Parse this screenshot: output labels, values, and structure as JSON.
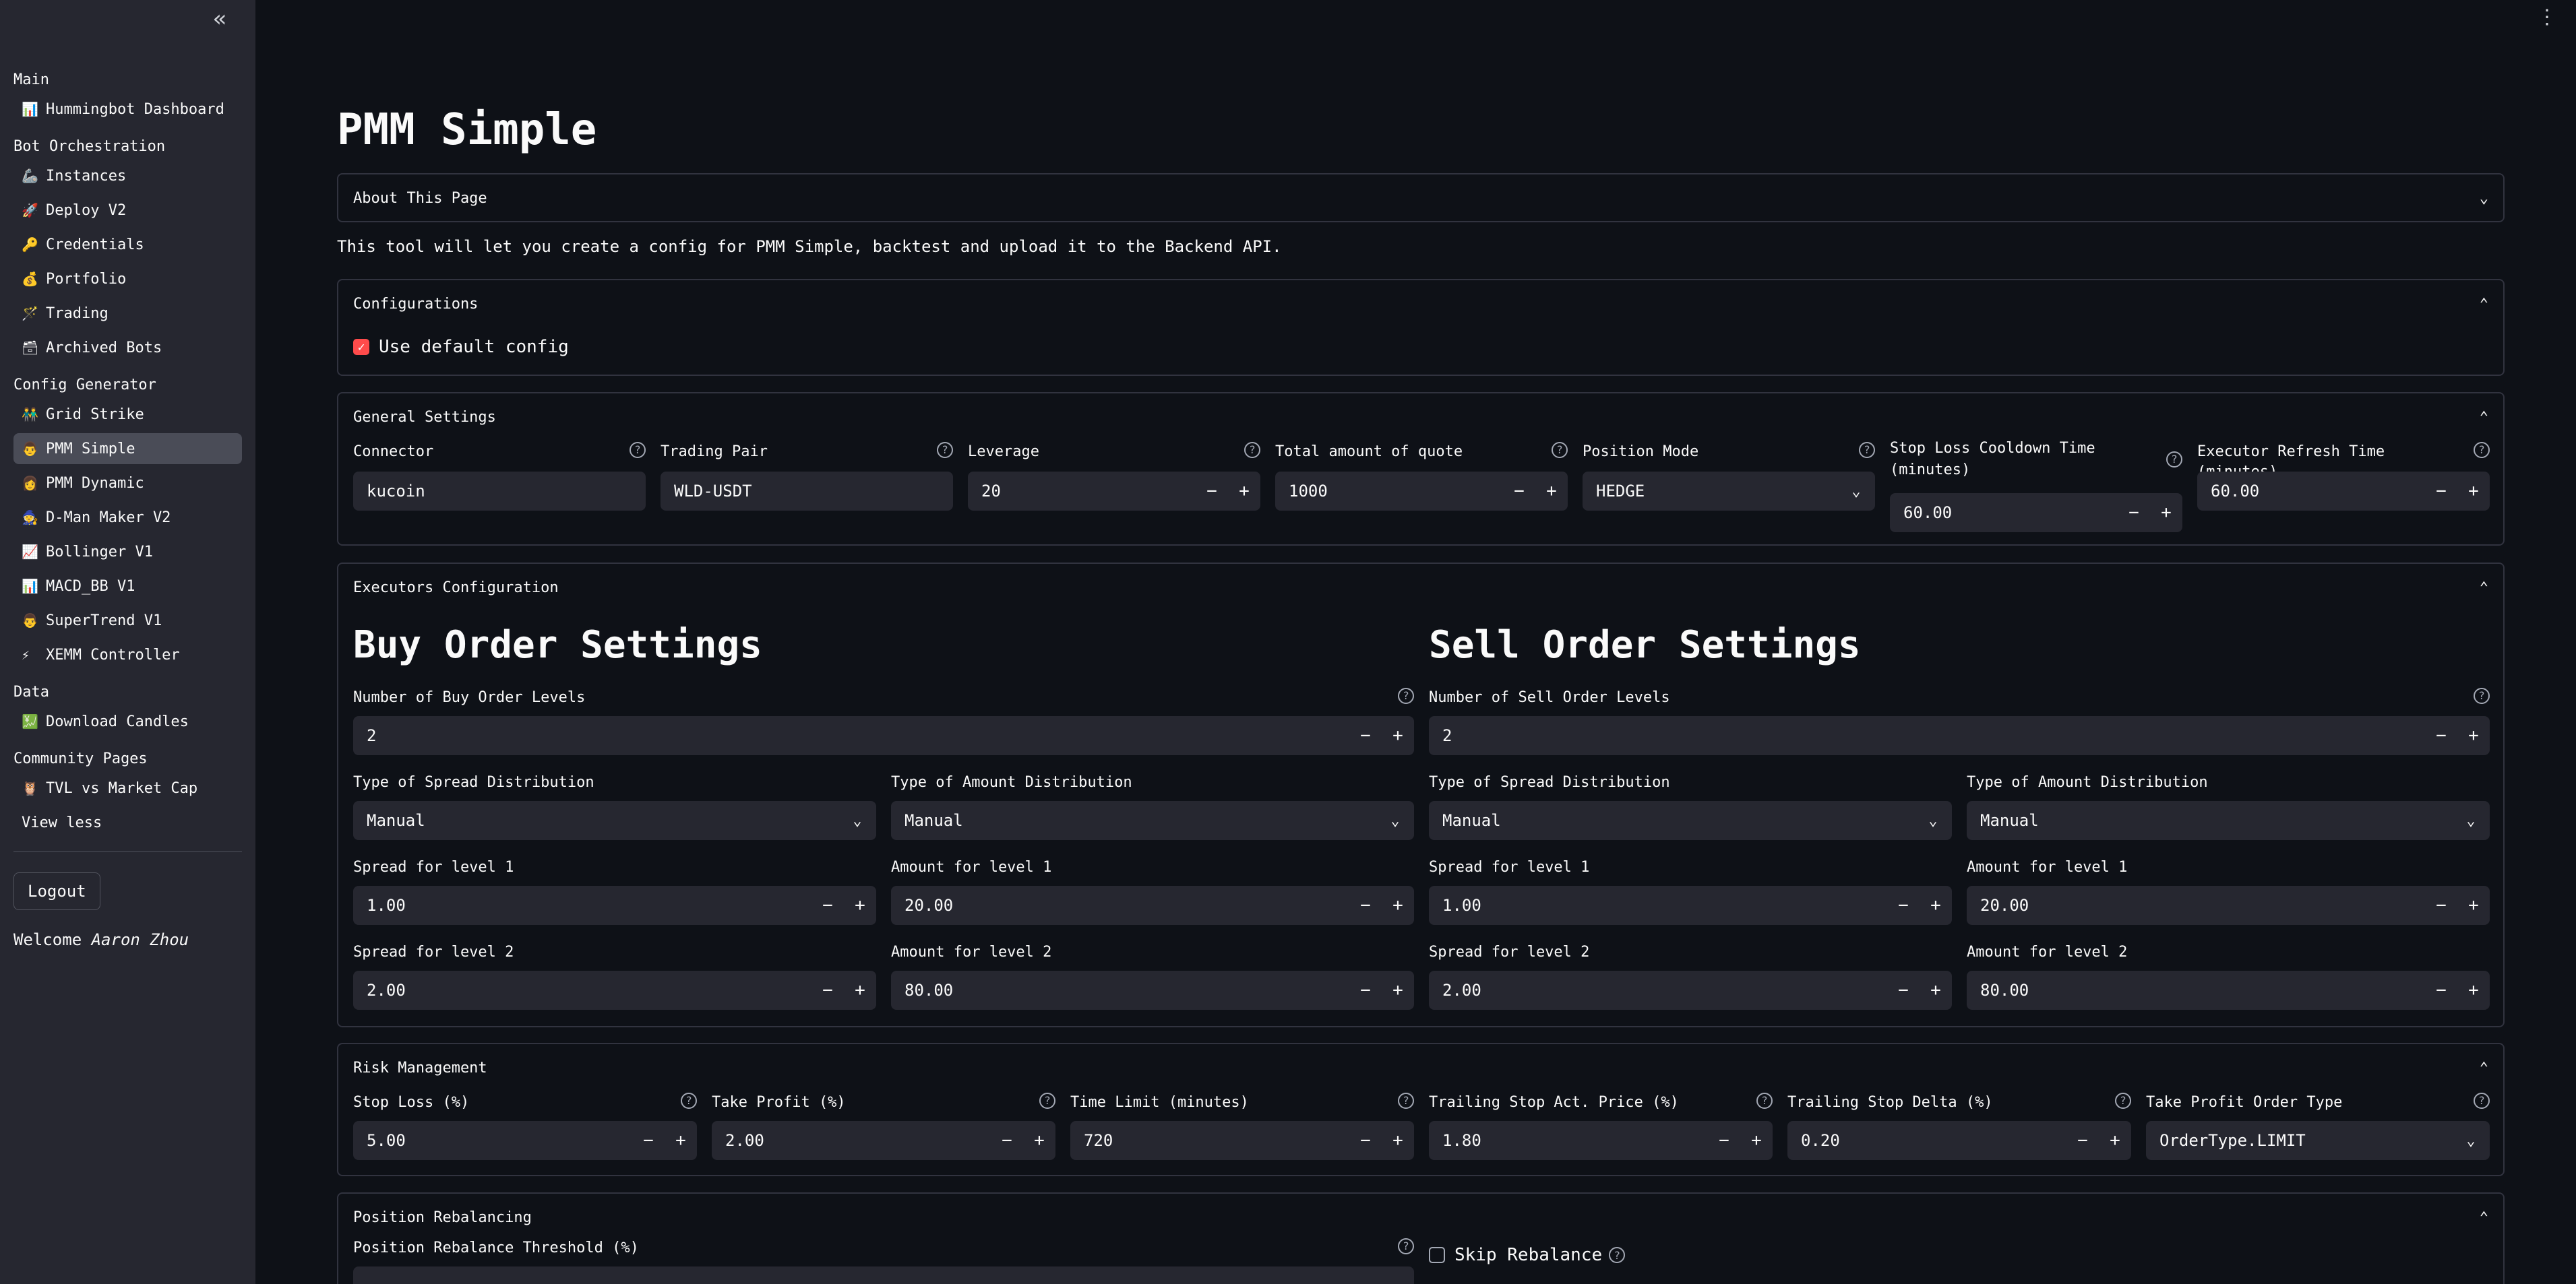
{
  "sidebar": {
    "collapse_icon": "«",
    "sections": {
      "main": "Main",
      "bot": "Bot Orchestration",
      "config": "Config Generator",
      "data": "Data",
      "community": "Community Pages"
    },
    "items": {
      "dashboard": {
        "icon": "📊",
        "label": "Hummingbot Dashboard"
      },
      "instances": {
        "icon": "🦾",
        "label": "Instances"
      },
      "deploy": {
        "icon": "🚀",
        "label": "Deploy V2"
      },
      "credentials": {
        "icon": "🔑",
        "label": "Credentials"
      },
      "portfolio": {
        "icon": "💰",
        "label": "Portfolio"
      },
      "trading": {
        "icon": "🪄",
        "label": "Trading"
      },
      "archived": {
        "icon": "🗃",
        "label": "Archived Bots"
      },
      "grid": {
        "icon": "👬",
        "label": "Grid Strike"
      },
      "pmm_simple": {
        "icon": "👨",
        "label": "PMM Simple"
      },
      "pmm_dynamic": {
        "icon": "👩",
        "label": "PMM Dynamic"
      },
      "dman": {
        "icon": "🧙",
        "label": "D-Man Maker V2"
      },
      "bollinger": {
        "icon": "📈",
        "label": "Bollinger V1"
      },
      "macd": {
        "icon": "📊",
        "label": "MACD_BB V1"
      },
      "supertrend": {
        "icon": "👨",
        "label": "SuperTrend V1"
      },
      "xemm": {
        "icon": "⚡",
        "label": "XEMM Controller"
      },
      "candles": {
        "icon": "💹",
        "label": "Download Candles"
      },
      "tvl": {
        "icon": "🦉",
        "label": "TVL vs Market Cap"
      }
    },
    "view_less": "View less",
    "logout": "Logout",
    "welcome_prefix": "Welcome",
    "welcome_user": "Aaron Zhou"
  },
  "menu_icon": "⋮",
  "page": {
    "title": "PMM Simple",
    "about_label": "About This Page",
    "description": "This tool will let you create a config for PMM Simple, backtest and upload it to the Backend API."
  },
  "configurations": {
    "label": "Configurations",
    "use_default": "Use default config",
    "use_default_checked": true
  },
  "general": {
    "label": "General Settings",
    "connector": {
      "label": "Connector",
      "value": "kucoin"
    },
    "trading_pair": {
      "label": "Trading Pair",
      "value": "WLD-USDT"
    },
    "leverage": {
      "label": "Leverage",
      "value": "20"
    },
    "total_quote": {
      "label": "Total amount of quote",
      "value": "1000"
    },
    "position_mode": {
      "label": "Position Mode",
      "value": "HEDGE"
    },
    "sl_cooldown": {
      "label": "Stop Loss Cooldown Time (minutes)",
      "value": "60.00"
    },
    "refresh_time": {
      "label": "Executor Refresh Time (minutes)",
      "value": "60.00"
    }
  },
  "executors": {
    "label": "Executors Configuration",
    "buy": {
      "title": "Buy Order Settings",
      "levels_label": "Number of Buy Order Levels",
      "levels": "2",
      "spread_dist_label": "Type of Spread Distribution",
      "spread_dist": "Manual",
      "amount_dist_label": "Type of Amount Distribution",
      "amount_dist": "Manual",
      "spread1_label": "Spread for level 1",
      "spread1": "1.00",
      "amount1_label": "Amount for level 1",
      "amount1": "20.00",
      "spread2_label": "Spread for level 2",
      "spread2": "2.00",
      "amount2_label": "Amount for level 2",
      "amount2": "80.00"
    },
    "sell": {
      "title": "Sell Order Settings",
      "levels_label": "Number of Sell Order Levels",
      "levels": "2",
      "spread_dist_label": "Type of Spread Distribution",
      "spread_dist": "Manual",
      "amount_dist_label": "Type of Amount Distribution",
      "amount_dist": "Manual",
      "spread1_label": "Spread for level 1",
      "spread1": "1.00",
      "amount1_label": "Amount for level 1",
      "amount1": "20.00",
      "spread2_label": "Spread for level 2",
      "spread2": "2.00",
      "amount2_label": "Amount for level 2",
      "amount2": "80.00"
    }
  },
  "risk": {
    "label": "Risk Management",
    "stop_loss": {
      "label": "Stop Loss (%)",
      "value": "5.00"
    },
    "take_profit": {
      "label": "Take Profit (%)",
      "value": "2.00"
    },
    "time_limit": {
      "label": "Time Limit (minutes)",
      "value": "720"
    },
    "trailing_act": {
      "label": "Trailing Stop Act. Price (%)",
      "value": "1.80"
    },
    "trailing_delta": {
      "label": "Trailing Stop Delta (%)",
      "value": "0.20"
    },
    "tp_order_type": {
      "label": "Take Profit Order Type",
      "value": "OrderType.LIMIT"
    }
  },
  "rebalancing": {
    "label": "Position Rebalancing",
    "threshold_label": "Position Rebalance Threshold (%)",
    "skip_label": "Skip Rebalance",
    "skip_checked": false
  },
  "symbols": {
    "minus": "−",
    "plus": "+",
    "help": "?",
    "chev_up": "⌃",
    "chev_down": "⌄",
    "caret": "⌄",
    "check": "✓"
  }
}
